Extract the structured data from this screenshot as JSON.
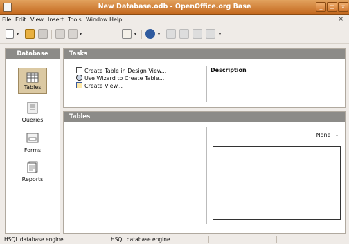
{
  "window": {
    "title": "New Database.odb - OpenOffice.org Base",
    "minimize": "_",
    "maximize": "□",
    "close": "x"
  },
  "menubar": {
    "items": [
      {
        "label": "File"
      },
      {
        "label": "Edit"
      },
      {
        "label": "View"
      },
      {
        "label": "Insert"
      },
      {
        "label": "Tools"
      },
      {
        "label": "Window"
      },
      {
        "label": "Help"
      }
    ],
    "doc_close": "×"
  },
  "toolbar": {
    "icons": [
      "new-document-icon",
      "open-folder-icon",
      "save-icon",
      "edit-icon",
      "form-icon",
      "sort-ascending-icon",
      "sort-descending-icon",
      "report-icon",
      "help-icon",
      "query-icon",
      "table-icon",
      "view-icon",
      "relations-icon"
    ]
  },
  "sidebar": {
    "title": "Database",
    "items": [
      {
        "label": "Tables",
        "icon": "tables-icon",
        "selected": true
      },
      {
        "label": "Queries",
        "icon": "queries-icon",
        "selected": false
      },
      {
        "label": "Forms",
        "icon": "forms-icon",
        "selected": false
      },
      {
        "label": "Reports",
        "icon": "reports-icon",
        "selected": false
      }
    ]
  },
  "tasks": {
    "title": "Tasks",
    "items": [
      {
        "label": "Create Table in Design View...",
        "icon": "design-view-icon"
      },
      {
        "label": "Use Wizard to Create Table...",
        "icon": "wizard-icon"
      },
      {
        "label": "Create View...",
        "icon": "create-view-icon"
      }
    ],
    "description_label": "Description"
  },
  "tables": {
    "title": "Tables",
    "preview_mode": "None"
  },
  "statusbar": {
    "fields": [
      "HSQL database engine",
      "HSQL database engine",
      "",
      ""
    ]
  },
  "colors": {
    "titlebar": "#c4691f",
    "panel_header": "#8c8b88",
    "selected_item": "#dbc9a3",
    "background": "#efebe7"
  }
}
